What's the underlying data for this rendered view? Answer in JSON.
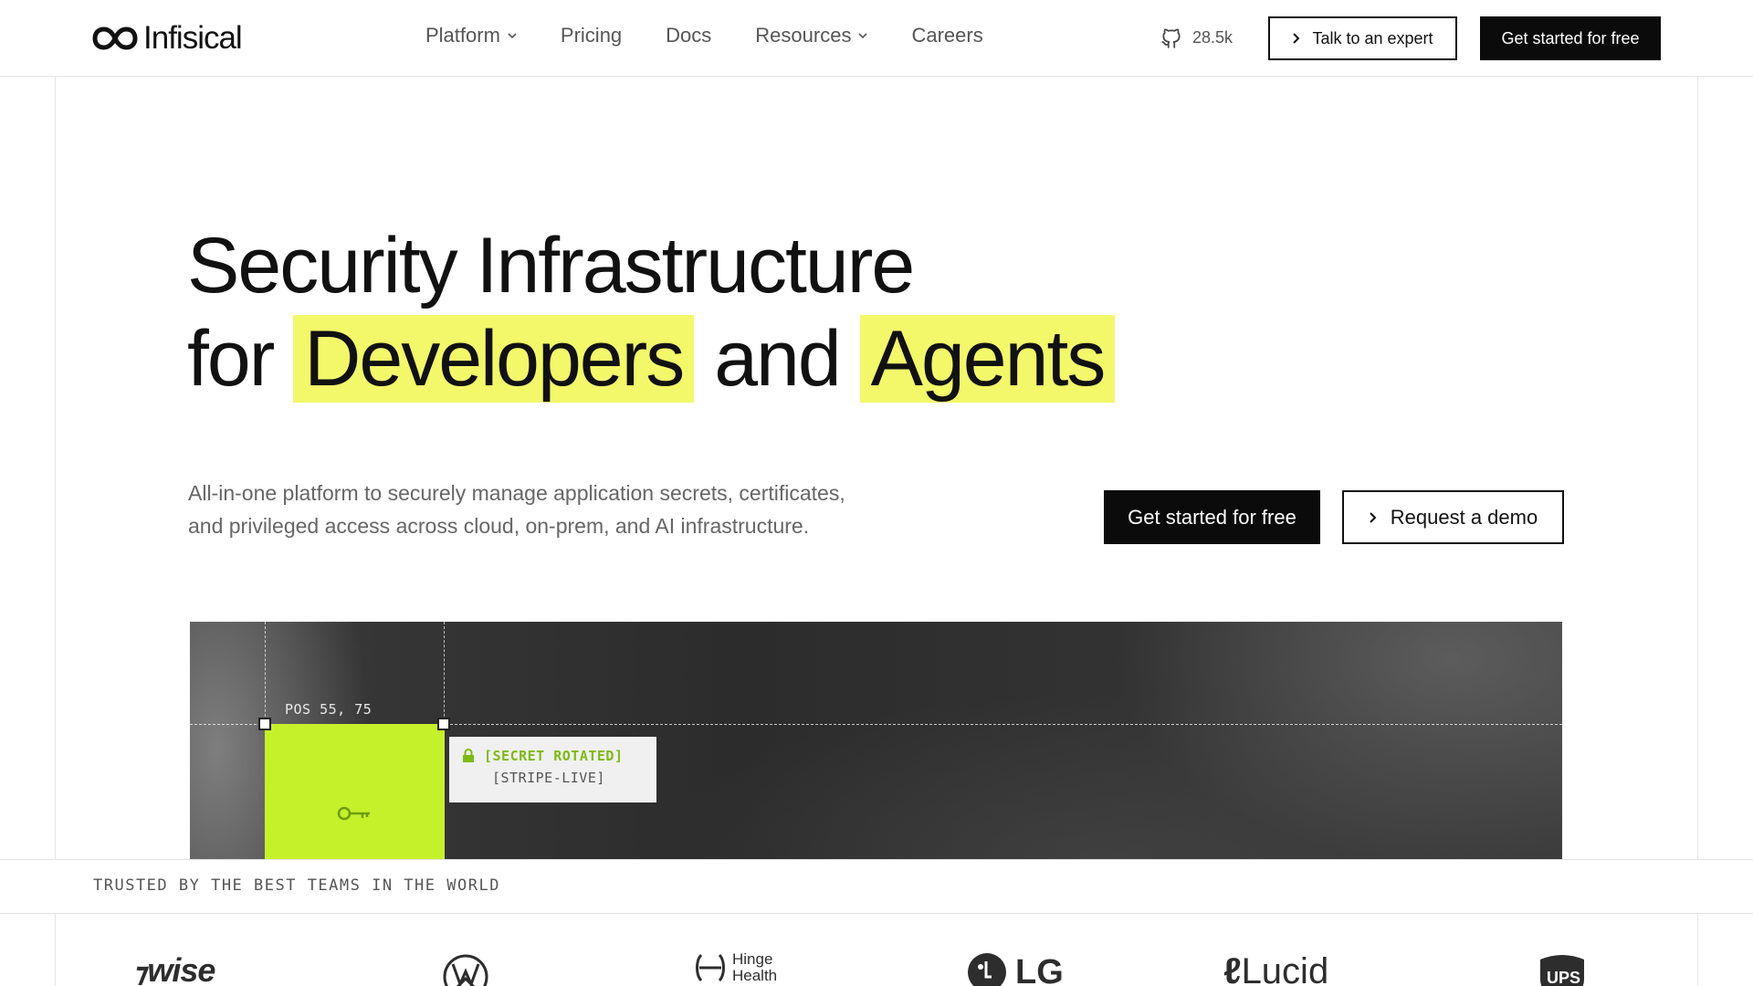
{
  "nav": {
    "logo": "Infisical",
    "menu": [
      {
        "label": "Platform",
        "dropdown": true
      },
      {
        "label": "Pricing",
        "dropdown": false
      },
      {
        "label": "Docs",
        "dropdown": false
      },
      {
        "label": "Resources",
        "dropdown": true
      },
      {
        "label": "Careers",
        "dropdown": false
      }
    ],
    "github_stars": "28.5k",
    "talk_expert": "Talk to an expert",
    "get_started": "Get started for free"
  },
  "hero": {
    "line1": "Security Infrastructure",
    "line2_pre": "for",
    "line2_h1": "Developers",
    "line2_mid": "and",
    "line2_h2": "Agents",
    "subtitle_1": "All-in-one platform to securely manage application secrets, certificates,",
    "subtitle_2": "and privileged access across cloud, on-prem, and AI infrastructure.",
    "cta_primary": "Get started for free",
    "cta_secondary": "Request a demo"
  },
  "visual": {
    "pos_label": "POS 55, 75",
    "toast_title": "[SECRET ROTATED]",
    "toast_sub": "[STRIPE-LIVE]"
  },
  "trusted": {
    "label": "TRUSTED BY THE BEST TEAMS IN THE WORLD",
    "logos": [
      "wise",
      "Hinge Health",
      "LG",
      "Lucid",
      "UPS"
    ]
  },
  "colors": {
    "highlight": "#f2f86a",
    "accent_green": "#c5f12b",
    "dark": "#0b0b0b"
  }
}
